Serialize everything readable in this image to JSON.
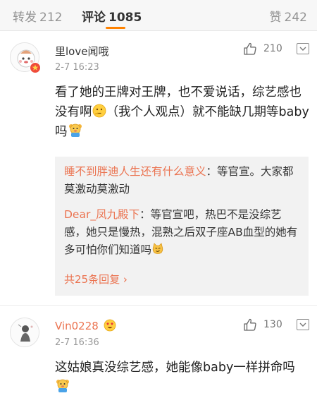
{
  "tabs": {
    "repost": {
      "label": "转发",
      "count": "212"
    },
    "comment": {
      "label": "评论",
      "count": "1085"
    },
    "like": {
      "label": "赞",
      "count": "242"
    }
  },
  "comments": [
    {
      "username": "里love闻哦",
      "timestamp": "2-7 16:23",
      "likes": "210",
      "text_part1": "看了她的王牌对王牌，也不爱说话，综艺感也没有啊",
      "text_part2": "（我个人观点）就不能缺几期等baby吗",
      "replies": [
        {
          "name": "睡不到胖迪人生还有什么意义",
          "text": "：等官宣。大家都莫激动莫激动"
        },
        {
          "name": "Dear_凤九殿下",
          "text": "：等官宣吧，热巴不是没综艺感，她只是慢热，混熟之后双子座AB血型的她有多可怕你们知道吗"
        }
      ],
      "more_replies": "共25条回复 ›"
    },
    {
      "username": "Vin0228",
      "timestamp": "2-7 16:36",
      "likes": "130",
      "text": "这姑娘真没综艺感，她能像baby一样拼命吗"
    }
  ],
  "icons": {
    "like": "thumbs-up-icon",
    "more": "chevron-down-icon",
    "emoji_think": "thinking-face-emoji",
    "emoji_bear": "baby-bear-emoji",
    "emoji_cat": "smirking-cat-emoji",
    "emoji_hearts": "heart-eyes-emoji"
  },
  "colors": {
    "accent": "#ff8200",
    "username_link": "#eb7350",
    "reply_bg": "#f2f2f2"
  }
}
